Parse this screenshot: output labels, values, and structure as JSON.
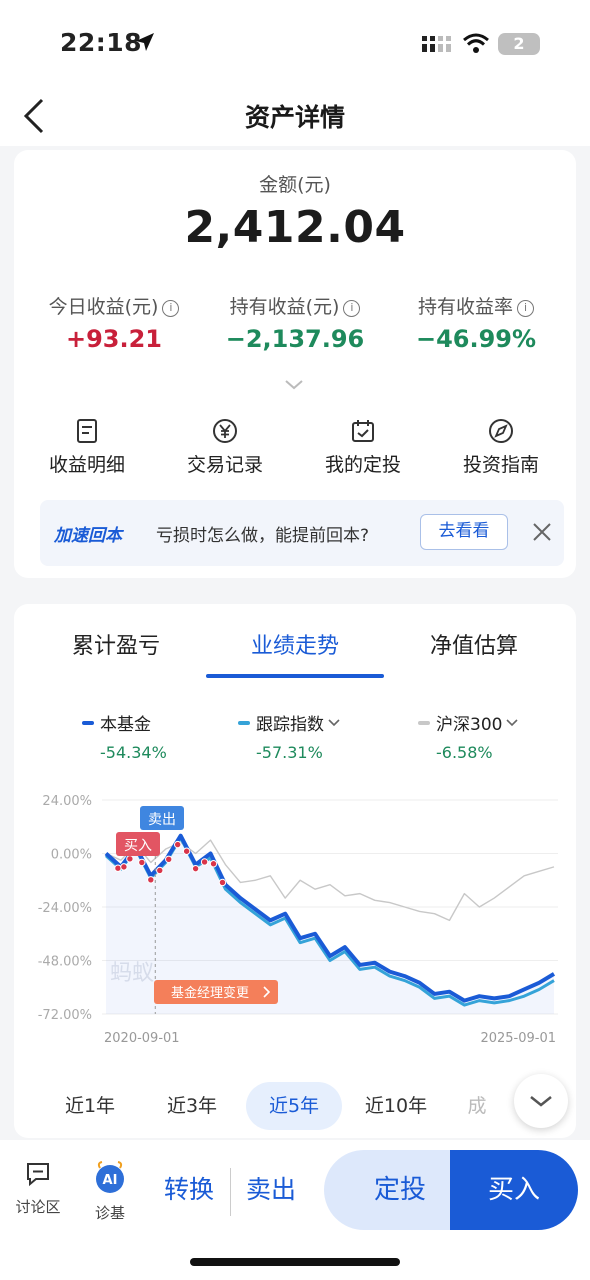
{
  "status_bar": {
    "time": "22:18",
    "battery": "2"
  },
  "nav": {
    "title": "资产详情"
  },
  "summary": {
    "amount_label": "金额(元)",
    "amount_value": "2,412.04",
    "stats": [
      {
        "label": "今日收益(元)",
        "value": "+93.21",
        "tone": "positive"
      },
      {
        "label": "持有收益(元)",
        "value": "−2,137.96",
        "tone": "negative"
      },
      {
        "label": "持有收益率",
        "value": "−46.99%",
        "tone": "negative"
      }
    ],
    "info_glyph": "i"
  },
  "quick_actions": [
    {
      "label": "收益明细",
      "icon": "document-icon"
    },
    {
      "label": "交易记录",
      "icon": "yuan-icon"
    },
    {
      "label": "我的定投",
      "icon": "calendar-icon"
    },
    {
      "label": "投资指南",
      "icon": "compass-icon"
    }
  ],
  "promo": {
    "tag": "加速回本",
    "text": "亏损时怎么做，能提前回本?",
    "button": "去看看"
  },
  "tabs": [
    {
      "label": "累计盈亏",
      "active": false
    },
    {
      "label": "业绩走势",
      "active": true
    },
    {
      "label": "净值估算",
      "active": false
    }
  ],
  "legend": [
    {
      "name": "本基金",
      "value": "-54.34%",
      "color": "#1a5bd6",
      "dropdown": false
    },
    {
      "name": "跟踪指数",
      "value": "-57.31%",
      "color": "#35a3d8",
      "dropdown": true
    },
    {
      "name": "沪深300",
      "value": "-6.58%",
      "color": "#c8c8c8",
      "dropdown": true
    }
  ],
  "chart_data": {
    "type": "line",
    "y_ticks": [
      "24.00%",
      "0.00%",
      "-24.00%",
      "-48.00%",
      "-72.00%"
    ],
    "ylim": [
      -72,
      24
    ],
    "x_start_label": "2020-09-01",
    "x_end_label": "2025-09-01",
    "series": [
      {
        "name": "本基金",
        "color": "#1a5bd6",
        "values": [
          0,
          -6,
          3,
          -10,
          -3,
          8,
          -5,
          0,
          -14,
          -20,
          -25,
          -30,
          -27,
          -38,
          -36,
          -46,
          -42,
          -50,
          -49,
          -53,
          -55,
          -58,
          -63,
          -62,
          -66,
          -64,
          -65,
          -64,
          -61,
          -58,
          -54
        ]
      },
      {
        "name": "跟踪指数",
        "color": "#35a3d8",
        "values": [
          -1,
          -7,
          2,
          -11,
          -4,
          7,
          -6,
          -2,
          -16,
          -22,
          -27,
          -32,
          -29,
          -40,
          -38,
          -48,
          -44,
          -52,
          -51,
          -55,
          -57,
          -60,
          -65,
          -64,
          -68,
          -66,
          -67,
          -66,
          -64,
          -61,
          -57
        ]
      },
      {
        "name": "沪深300",
        "color": "#c8c8c8",
        "values": [
          0,
          -3,
          4,
          -4,
          2,
          5,
          0,
          6,
          -5,
          -13,
          -12,
          -10,
          -20,
          -12,
          -16,
          -14,
          -19,
          -18,
          -21,
          -22,
          -24,
          -26,
          -27,
          -30,
          -18,
          -24,
          -20,
          -15,
          -10,
          -8,
          -6
        ]
      }
    ],
    "markers": {
      "buy": "买入",
      "sell": "卖出",
      "event": "基金经理变更"
    },
    "watermark": "蚂蚁"
  },
  "ranges": [
    {
      "label": "近1年",
      "active": false
    },
    {
      "label": "近3年",
      "active": false
    },
    {
      "label": "近5年",
      "active": true
    },
    {
      "label": "近10年",
      "active": false
    },
    {
      "label": "成",
      "active": false
    }
  ],
  "bottom": {
    "discuss": "讨论区",
    "diagnose": "诊基",
    "ai_badge": "AI",
    "convert": "转换",
    "sell": "卖出",
    "dingtou": "定投",
    "buy": "买入"
  }
}
